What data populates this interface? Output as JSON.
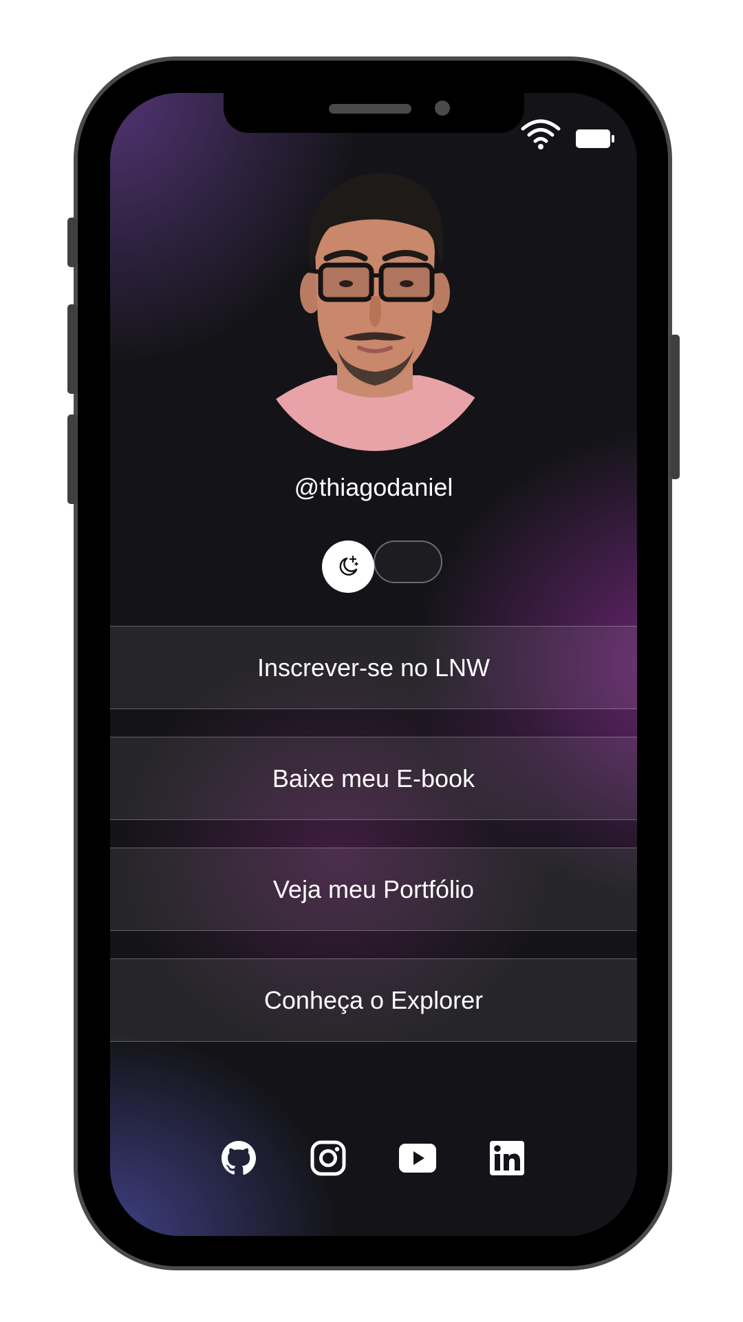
{
  "profile": {
    "username": "@thiagodaniel",
    "avatar_alt": "profile photo"
  },
  "theme_toggle": {
    "icon": "moon-stars-icon",
    "state": "dark"
  },
  "links": [
    {
      "label": "Inscrever-se no LNW"
    },
    {
      "label": "Baixe meu E-book"
    },
    {
      "label": "Veja meu Portfólio"
    },
    {
      "label": "Conheça o Explorer"
    }
  ],
  "socials": [
    {
      "icon": "github-icon"
    },
    {
      "icon": "instagram-icon"
    },
    {
      "icon": "youtube-icon"
    },
    {
      "icon": "linkedin-icon"
    }
  ],
  "status_bar": {
    "icons": [
      "wifi-icon",
      "battery-icon"
    ]
  },
  "colors": {
    "background": "#141418",
    "accent_purple": "#7a2a85",
    "text": "#ffffff"
  }
}
